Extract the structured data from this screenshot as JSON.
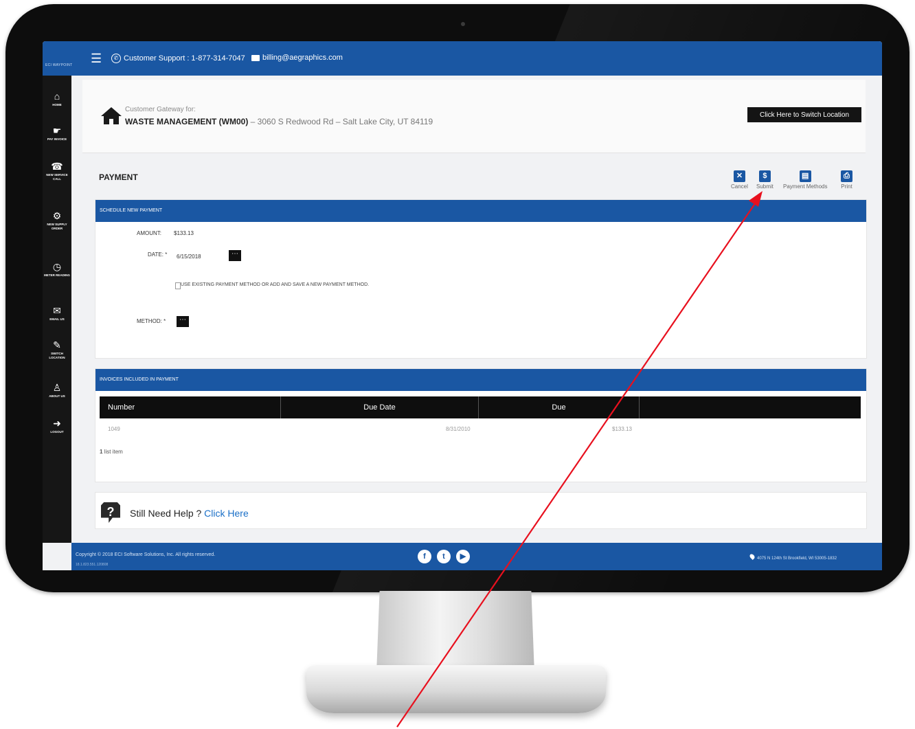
{
  "topbar": {
    "logo": "ECI WAYPOINT",
    "support": "Customer Support : 1-877-314-7047",
    "email": "billing@aegraphics.com"
  },
  "sidebar": {
    "items": [
      {
        "icon": "home-icon",
        "label": "HOME"
      },
      {
        "icon": "pay-invoice-icon",
        "label": "PAY INVOICE"
      },
      {
        "icon": "service-call-icon",
        "label": "NEW SERVICE CALL"
      },
      {
        "icon": "supply-order-icon",
        "label": "NEW SUPPLY ORDER"
      },
      {
        "icon": "meter-icon",
        "label": "METER READING"
      },
      {
        "icon": "email-icon",
        "label": "EMAIL US"
      },
      {
        "icon": "switch-location-icon",
        "label": "SWITCH LOCATION"
      },
      {
        "icon": "user-icon",
        "label": "ABOUT US"
      },
      {
        "icon": "logout-icon",
        "label": "LOGOUT"
      }
    ]
  },
  "gateway": {
    "label": "Customer Gateway for:",
    "name": "WASTE MANAGEMENT (WM00)",
    "address": " – 3060 S Redwood Rd – Salt Lake City, UT 84119",
    "switch_button": "Click Here to Switch Location"
  },
  "payment": {
    "title": "PAYMENT",
    "toolbar": {
      "cancel": "Cancel",
      "submit": "Submit",
      "methods": "Payment Methods",
      "print": "Print"
    },
    "schedule": {
      "header": "SCHEDULE NEW PAYMENT",
      "amount_label": "AMOUNT:",
      "amount_value": "$133.13",
      "date_label": "DATE: ",
      "date_value": "6/15/2018",
      "checkbox_text": "USE EXISTING PAYMENT METHOD OR ADD AND SAVE A NEW PAYMENT METHOD.",
      "method_label": "METHOD: "
    },
    "invoices": {
      "header": "INVOICES INCLUDED IN PAYMENT",
      "columns": [
        "Number",
        "Due Date",
        "Due"
      ],
      "rows": [
        {
          "number": "1049",
          "due_date": "8/31/2010",
          "due": "$133.13"
        }
      ],
      "count": "1",
      "count_label": "list item"
    }
  },
  "help": {
    "text": "Still Need Help ? ",
    "link": "Click Here"
  },
  "footer": {
    "copyright": "Copyright © 2018 ECI Software Solutions, Inc. All rights reserved.",
    "version": "18.1.823.551.120808",
    "address": "4075 N 124th St Brookfield, WI 53005-1832"
  },
  "colors": {
    "brand_blue": "#1a57a3",
    "sidebar": "#161616",
    "annotation_arrow": "#e8101e"
  }
}
